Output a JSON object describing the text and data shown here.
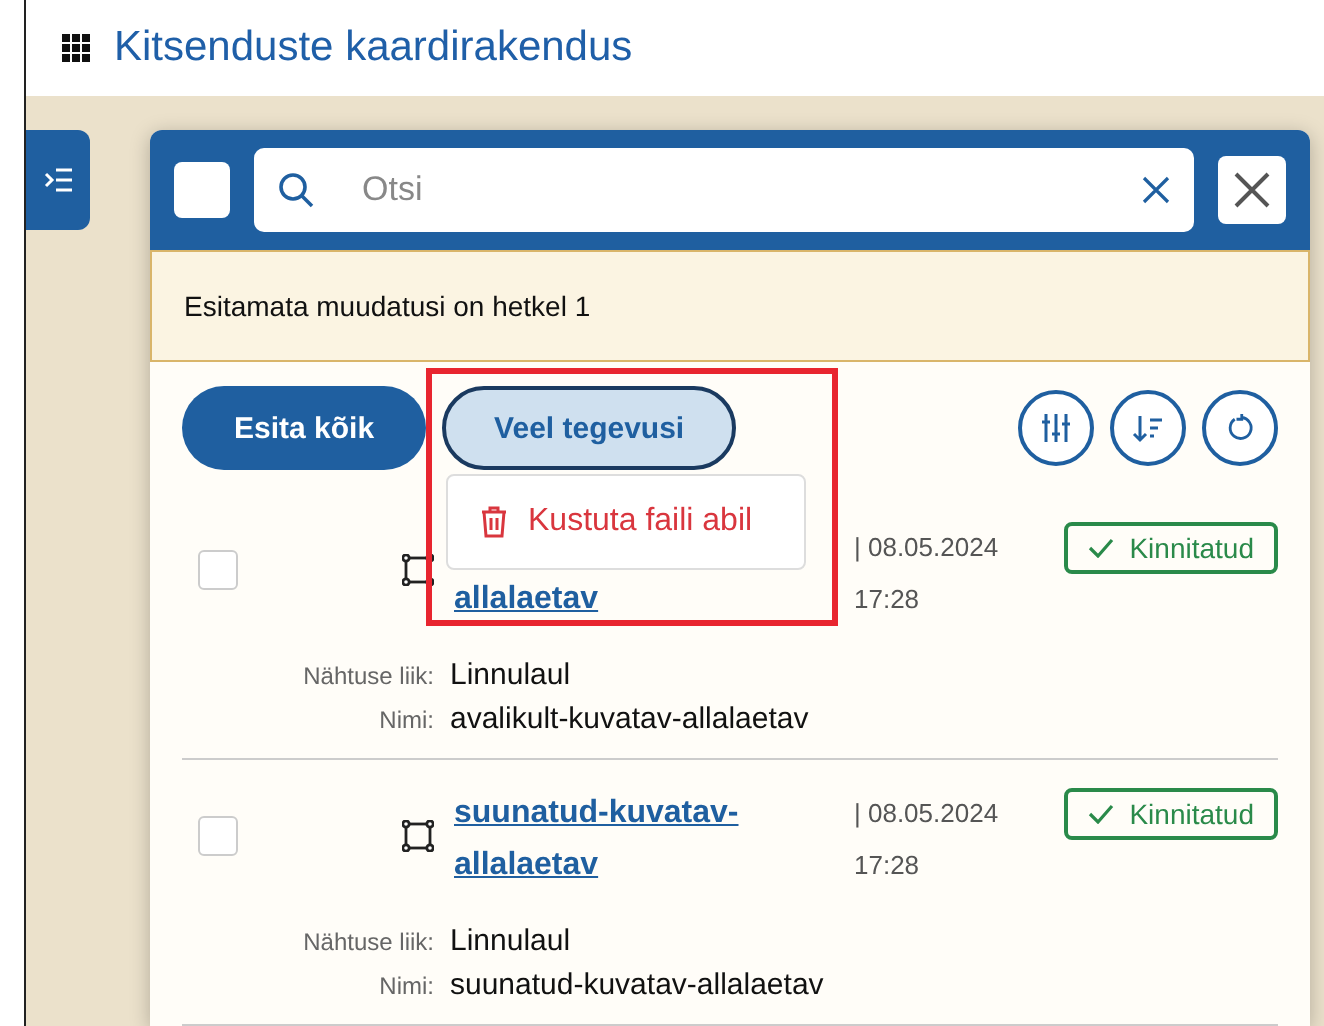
{
  "app_title": "Kitsenduste kaardirakendus",
  "panel": {
    "select_all_checked": false,
    "search": {
      "placeholder": "Otsi"
    },
    "notice": "Esitamata muudatusi on hetkel 1",
    "actions": {
      "submit_all": "Esita kõik",
      "more_actions": "Veel tegevusi",
      "more_actions_expanded": true
    },
    "menu": [
      {
        "label": "Kustuta faili abil"
      }
    ],
    "items": [
      {
        "checked": false,
        "title_line2": "allalaetav",
        "date": "| 08.05.2024",
        "time": "17:28",
        "status": "Kinnitatud",
        "fields": [
          {
            "label": "Nähtuse liik:",
            "value": "Linnulaul"
          },
          {
            "label": "Nimi:",
            "value": "avalikult-kuvatav-allalaetav"
          }
        ]
      },
      {
        "checked": false,
        "title_line1": "suunatud-kuvatav-",
        "title_line2": "allalaetav",
        "date": "| 08.05.2024",
        "time": "17:28",
        "status": "Kinnitatud",
        "fields": [
          {
            "label": "Nähtuse liik:",
            "value": "Linnulaul"
          },
          {
            "label": "Nimi:",
            "value": "suunatud-kuvatav-allalaetav"
          }
        ]
      }
    ]
  }
}
